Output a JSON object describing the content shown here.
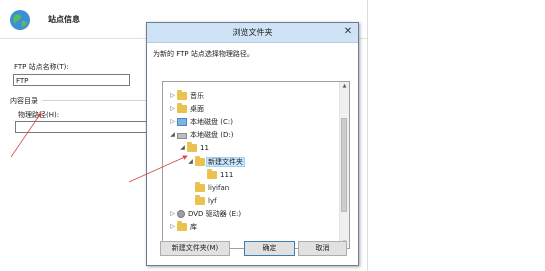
{
  "wizard": {
    "title": "站点信息",
    "ftp_site_name_label": "FTP 站点名称(T):",
    "ftp_site_name_value": "FTP",
    "content_dir_label": "内容目录",
    "physical_path_label": "物理路径(H):",
    "physical_path_value": ""
  },
  "dialog": {
    "title": "浏览文件夹",
    "prompt": "为新的 FTP 站点选择物理路径。",
    "tree": [
      {
        "label": "音乐",
        "icon": "music-folder-icon",
        "expander": "collapsed"
      },
      {
        "label": "桌面",
        "icon": "desktop-folder-icon",
        "expander": "collapsed"
      },
      {
        "label": "本地磁盘 (C:)",
        "icon": "windows-drive-icon",
        "expander": "collapsed"
      },
      {
        "label": "本地磁盘 (D:)",
        "icon": "drive-icon",
        "expander": "expanded"
      },
      {
        "label": "11",
        "icon": "folder-icon",
        "expander": "expanded"
      },
      {
        "label": "新建文件夹",
        "icon": "folder-icon",
        "expander": "expanded",
        "selected": true
      },
      {
        "label": "111",
        "icon": "folder-icon",
        "expander": "none"
      },
      {
        "label": "liyifan",
        "icon": "folder-icon",
        "expander": "none"
      },
      {
        "label": "lyf",
        "icon": "folder-icon",
        "expander": "none"
      },
      {
        "label": "DVD 驱动器 (E:)",
        "icon": "dvd-drive-icon",
        "expander": "collapsed"
      },
      {
        "label": "库",
        "icon": "library-icon",
        "expander": "collapsed"
      }
    ],
    "new_folder_button": "新建文件夹(M)",
    "ok_button": "确定",
    "cancel_button": "取消",
    "close_glyph": "✕"
  },
  "colors": {
    "annotation_arrow": "#d64545",
    "titlebar": "#cfe3f7",
    "selection": "#cce8ff"
  }
}
